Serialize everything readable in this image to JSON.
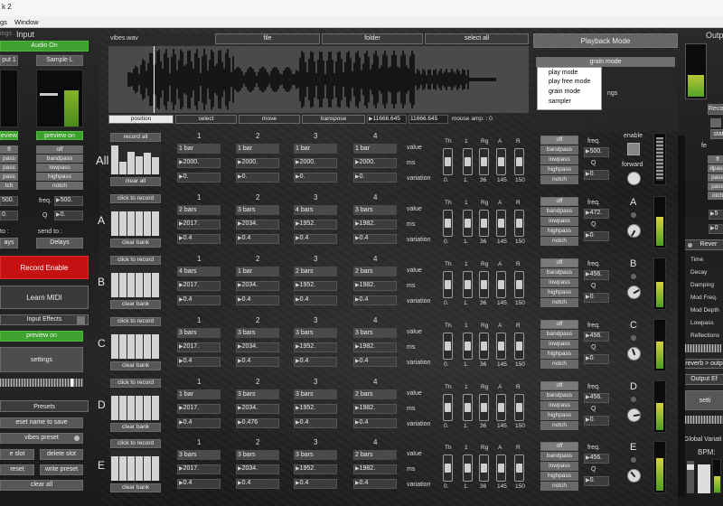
{
  "window": {
    "title": "k 2",
    "menus": [
      "gs",
      "Window"
    ]
  },
  "left": {
    "header_small": "ings",
    "header": "Input",
    "audio": "Audio On",
    "input_label": "put 1",
    "sample_label": "Sample L",
    "preview_left": "eview on",
    "preview_right": "preview on",
    "filters_left": [
      "ff",
      "pass",
      "pass",
      "pass",
      "tch"
    ],
    "filters_right": [
      "off",
      "bandpass",
      "lowpass",
      "highpass",
      "notch"
    ],
    "freq_left": "500.",
    "q_left": "0.",
    "freq_label": "freq.",
    "freq_value": "500.",
    "q_label": "Q",
    "q_value": "0.",
    "send_left": "to :",
    "send_label": "send to :",
    "delays_left": "ays",
    "delays_right": "Delays",
    "record_enable": "Record Enable",
    "learn_midi": "Learn MIDI",
    "input_effects": "Input Effects",
    "input_preview": "preview on",
    "settings": "settings",
    "presets": "Presets",
    "preset_name": "eset name to save",
    "vibes_preset": "vibes preset",
    "e_slot": "e slot",
    "delete_slot": "delete slot",
    "reset": "reset",
    "write_preset": "write preset",
    "clear_all": "clear all"
  },
  "file": {
    "name": "vibes.wav",
    "file_btn": "file",
    "folder_btn": "folder",
    "select_all": "select all"
  },
  "transport": {
    "position": "position",
    "select": "select",
    "move": "move",
    "transpose": "transpose",
    "val1": "11666.645",
    "val2": "11666.645",
    "mouse": "mouse amp. : 0."
  },
  "playback": {
    "title": "Playback Mode",
    "grain": "grain mode",
    "menu": [
      "play mode",
      "play free mode",
      "grain mode",
      "sampler"
    ],
    "settings_partial": "ngs"
  },
  "rows": [
    {
      "letter": "All",
      "record": "record all",
      "clear": "clear all",
      "bars": [
        95,
        40,
        75,
        60,
        70,
        55
      ],
      "cols": [
        {
          "n": "1",
          "v": "1 bar",
          "ms": "2000.",
          "var": "0."
        },
        {
          "n": "2",
          "v": "1 bar",
          "ms": "2000.",
          "var": "0."
        },
        {
          "n": "3",
          "v": "1 bar",
          "ms": "2000.",
          "var": "0."
        },
        {
          "n": "4",
          "v": "1 bar",
          "ms": "2000.",
          "var": "0."
        }
      ],
      "env": [
        "0.",
        "1.",
        "36",
        "145",
        "150"
      ],
      "filter_freq": "500.",
      "filter_q": "0."
    },
    {
      "letter": "A",
      "record": "click to record",
      "clear": "clear bank",
      "bars": [
        80,
        80,
        80,
        80,
        80,
        80
      ],
      "cols": [
        {
          "n": "1",
          "v": "2 bars",
          "ms": "2017.",
          "var": "0.4"
        },
        {
          "n": "2",
          "v": "3 bars",
          "ms": "2034.",
          "var": "0.4"
        },
        {
          "n": "3",
          "v": "4 bars",
          "ms": "1952.",
          "var": "0.4"
        },
        {
          "n": "4",
          "v": "3 bars",
          "ms": "1982.",
          "var": "0.4"
        }
      ],
      "env": [
        "0.",
        "1.",
        "36",
        "145",
        "150"
      ],
      "filter_freq": "472.",
      "filter_q": "0."
    },
    {
      "letter": "B",
      "record": "click to record",
      "clear": "clear bank",
      "bars": [
        80,
        80,
        80,
        80,
        80,
        80
      ],
      "cols": [
        {
          "n": "1",
          "v": "4 bars",
          "ms": "2017.",
          "var": "0.4"
        },
        {
          "n": "2",
          "v": "1 bar",
          "ms": "2034.",
          "var": "0.4"
        },
        {
          "n": "3",
          "v": "2 bars",
          "ms": "1952.",
          "var": "0.4"
        },
        {
          "n": "4",
          "v": "2 bars",
          "ms": "1982.",
          "var": "0.4"
        }
      ],
      "env": [
        "0.",
        "1.",
        "36",
        "145",
        "150"
      ],
      "filter_freq": "456.",
      "filter_q": "0."
    },
    {
      "letter": "C",
      "record": "click to record",
      "clear": "clear bank",
      "bars": [
        80,
        80,
        80,
        80,
        80,
        80
      ],
      "cols": [
        {
          "n": "1",
          "v": "3 bars",
          "ms": "2017.",
          "var": "0.4"
        },
        {
          "n": "2",
          "v": "3 bars",
          "ms": "2034.",
          "var": "0.4"
        },
        {
          "n": "3",
          "v": "3 bars",
          "ms": "1952.",
          "var": "0.4"
        },
        {
          "n": "4",
          "v": "3 bars",
          "ms": "1982.",
          "var": "0.4"
        }
      ],
      "env": [
        "0.",
        "1.",
        "36",
        "145",
        "150"
      ],
      "filter_freq": "456.",
      "filter_q": "0."
    },
    {
      "letter": "D",
      "record": "click to record",
      "clear": "clear bank",
      "bars": [
        80,
        80,
        80,
        80,
        80,
        80
      ],
      "cols": [
        {
          "n": "1",
          "v": "1 bar",
          "ms": "2017.",
          "var": "0.4"
        },
        {
          "n": "2",
          "v": "3 bars",
          "ms": "2034.",
          "var": "0.476"
        },
        {
          "n": "3",
          "v": "3 bars",
          "ms": "1952.",
          "var": "0.4"
        },
        {
          "n": "4",
          "v": "2 bars",
          "ms": "1982.",
          "var": "0.4"
        }
      ],
      "env": [
        "0.",
        "1.",
        "36",
        "145",
        "150"
      ],
      "filter_freq": "456.",
      "filter_q": "0."
    },
    {
      "letter": "E",
      "record": "click to record",
      "clear": "clear bank",
      "bars": [
        80,
        80,
        80,
        80,
        80,
        80
      ],
      "cols": [
        {
          "n": "1",
          "v": "3 bars",
          "ms": "2017.",
          "var": "0.4"
        },
        {
          "n": "2",
          "v": "3 bars",
          "ms": "2034.",
          "var": "0.4"
        },
        {
          "n": "3",
          "v": "3 bars",
          "ms": "1952.",
          "var": "0.4"
        },
        {
          "n": "4",
          "v": "2 bars",
          "ms": "1982.",
          "var": "0.4"
        }
      ],
      "env": [
        "0.",
        "1.",
        "36",
        "145",
        "150"
      ],
      "filter_freq": "456.",
      "filter_q": "0."
    }
  ],
  "row_labels": {
    "value": "value",
    "ms": "ms",
    "variation": "variation"
  },
  "env_heads": [
    "Th",
    "1",
    "Rg",
    "A",
    "R"
  ],
  "filter_opts": [
    "off",
    "bandpass",
    "lowpass",
    "highpass",
    "notch"
  ],
  "filter_freq_label": "freq.",
  "filter_q_label": "Q",
  "enable": {
    "label": "enable",
    "forward": "forward"
  },
  "right": {
    "output": "Output",
    "recor": "Recor",
    "stat": "stat",
    "fe": "fe",
    "settings_partial": "settin",
    "reverb": "Rever",
    "rev_params": [
      "Time",
      "Decay",
      "Damping",
      "Mod Freq.",
      "Mod Depth",
      "Lowpass",
      "Reflections"
    ],
    "rev_out": "reverb > outp",
    "output_eff": "Output Ef",
    "sett": "setti",
    "global": "Global Variati",
    "bpm": "BPM:",
    "items": [
      "ble",
      "ard"
    ],
    "fe_list": [
      "ff",
      "dpass",
      "pass",
      "pass",
      "otch"
    ],
    "freq_partial": "5",
    "q_partial": "0"
  }
}
